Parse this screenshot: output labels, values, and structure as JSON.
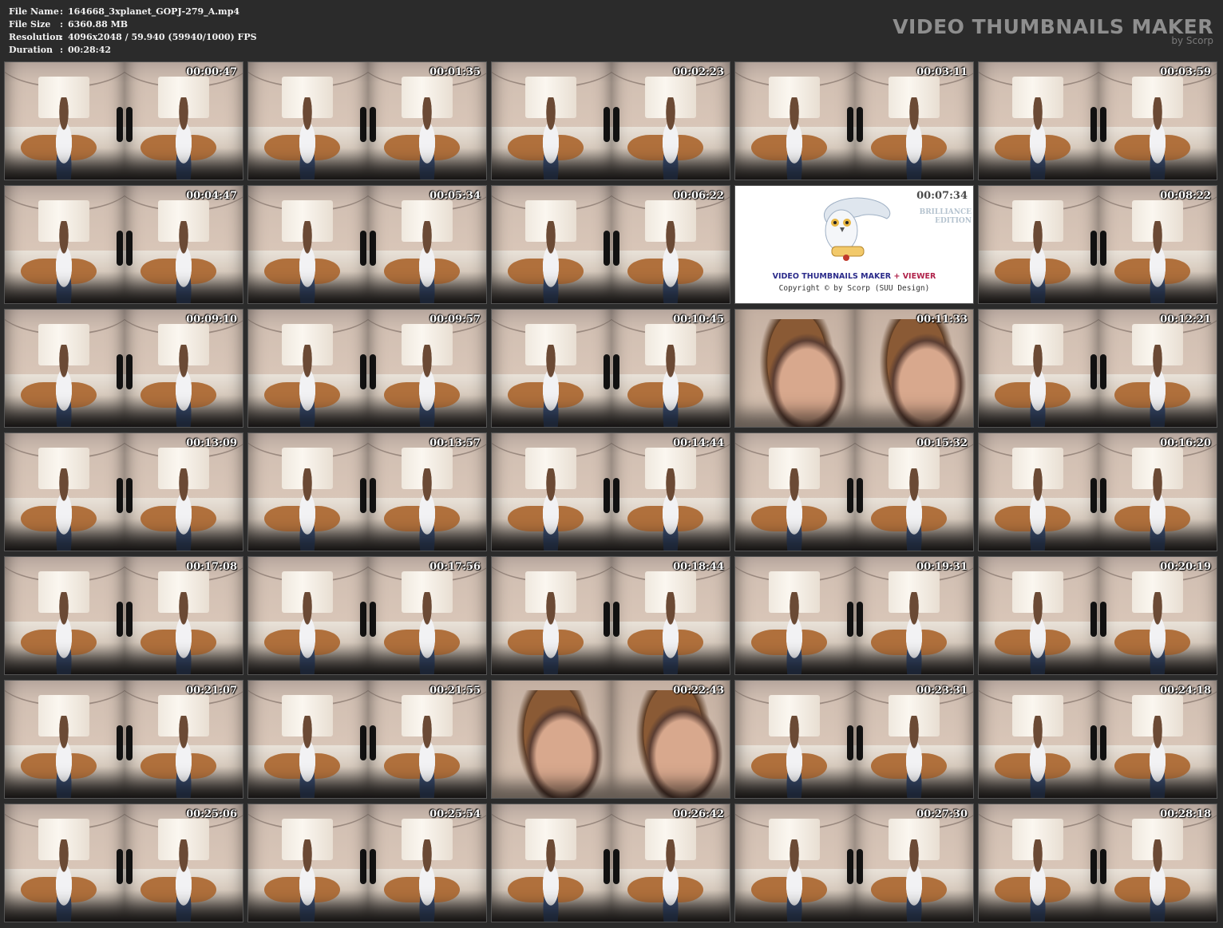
{
  "header": {
    "info": [
      {
        "key": "File Name",
        "sep": ":",
        "value": "164668_3xplanet_GOPJ-279_A.mp4"
      },
      {
        "key": "File Size",
        "sep": ":",
        "value": "6360.88 MB"
      },
      {
        "key": "Resolution",
        "sep": ":",
        "value": "4096x2048 / 59.940 (59940/1000) FPS"
      },
      {
        "key": "Duration",
        "sep": ":",
        "value": "00:28:42"
      }
    ],
    "brand_title": "VIDEO THUMBNAILS MAKER",
    "brand_sub": "by Scorp"
  },
  "thumbnails": [
    {
      "time": "00:00:47",
      "scene": "room"
    },
    {
      "time": "00:01:35",
      "scene": "room"
    },
    {
      "time": "00:02:23",
      "scene": "room"
    },
    {
      "time": "00:03:11",
      "scene": "room"
    },
    {
      "time": "00:03:59",
      "scene": "room"
    },
    {
      "time": "00:04:47",
      "scene": "room"
    },
    {
      "time": "00:05:34",
      "scene": "room"
    },
    {
      "time": "00:06:22",
      "scene": "room"
    },
    {
      "time": "00:07:34",
      "scene": "logo"
    },
    {
      "time": "00:08:22",
      "scene": "room"
    },
    {
      "time": "00:09:10",
      "scene": "room"
    },
    {
      "time": "00:09:57",
      "scene": "room"
    },
    {
      "time": "00:10:45",
      "scene": "room"
    },
    {
      "time": "00:11:33",
      "scene": "closeup"
    },
    {
      "time": "00:12:21",
      "scene": "room"
    },
    {
      "time": "00:13:09",
      "scene": "room"
    },
    {
      "time": "00:13:57",
      "scene": "room"
    },
    {
      "time": "00:14:44",
      "scene": "room"
    },
    {
      "time": "00:15:32",
      "scene": "room"
    },
    {
      "time": "00:16:20",
      "scene": "room"
    },
    {
      "time": "00:17:08",
      "scene": "room"
    },
    {
      "time": "00:17:56",
      "scene": "room"
    },
    {
      "time": "00:18:44",
      "scene": "room"
    },
    {
      "time": "00:19:31",
      "scene": "room"
    },
    {
      "time": "00:20:19",
      "scene": "room"
    },
    {
      "time": "00:21:07",
      "scene": "room"
    },
    {
      "time": "00:21:55",
      "scene": "room"
    },
    {
      "time": "00:22:43",
      "scene": "closeup"
    },
    {
      "time": "00:23:31",
      "scene": "room"
    },
    {
      "time": "00:24:18",
      "scene": "room"
    },
    {
      "time": "00:25:06",
      "scene": "room"
    },
    {
      "time": "00:25:54",
      "scene": "room"
    },
    {
      "time": "00:26:42",
      "scene": "room"
    },
    {
      "time": "00:27:30",
      "scene": "room"
    },
    {
      "time": "00:28:18",
      "scene": "room"
    }
  ],
  "logo_tile": {
    "edition": [
      "BRILLIANCE",
      "EDITION"
    ],
    "title_main": "VIDEO THUMBNAILS MAKER",
    "title_plus": "+ VIEWER",
    "copyright": "Copyright © by Scorp (SUU Design)"
  },
  "colors": {
    "background": "#2b2b2b",
    "brand_gray": "#8e8e8e",
    "logo_blue": "#2b2b8a",
    "logo_red": "#b0224a"
  },
  "icons": {
    "logo_icon": "owl-with-scroll-icon"
  }
}
